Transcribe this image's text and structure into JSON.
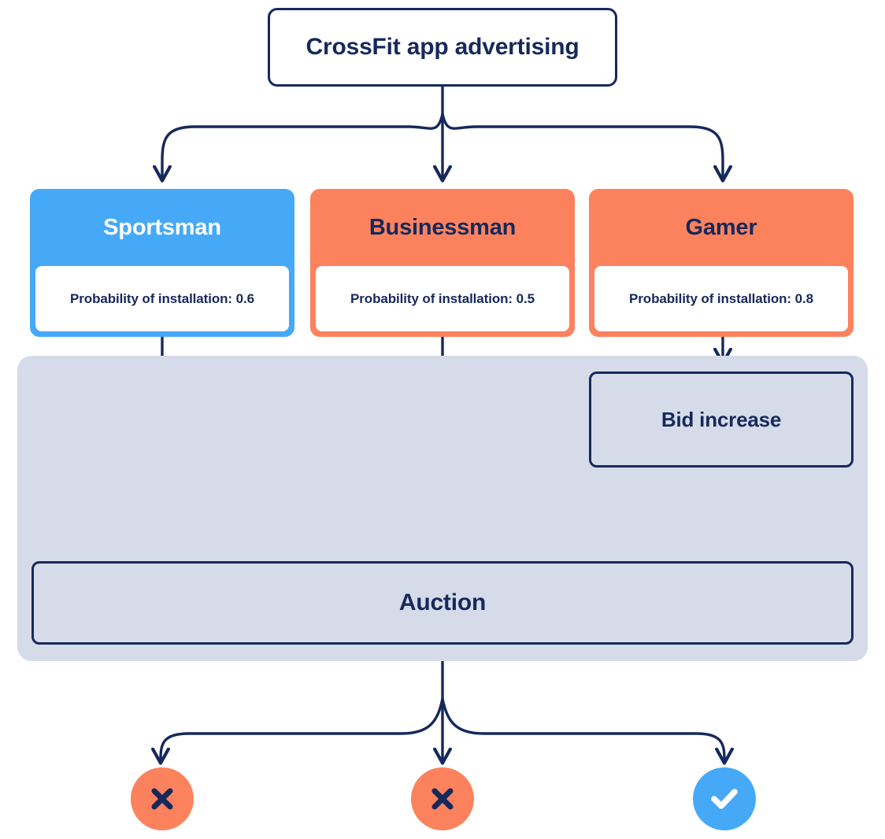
{
  "diagram": {
    "title_node": {
      "label": "CrossFit app advertising"
    },
    "segments": [
      {
        "name": "Sportsman",
        "probability_text": "Probability of installation: 0.6",
        "probability_value": 0.6,
        "color": "#45A9F7",
        "title_color": "#FFFFFF"
      },
      {
        "name": "Businessman",
        "probability_text": "Probability of installation: 0.5",
        "probability_value": 0.5,
        "color": "#FC825E",
        "title_color": "#16295C"
      },
      {
        "name": "Gamer",
        "probability_text": "Probability of installation: 0.8",
        "probability_value": 0.8,
        "color": "#FC825E",
        "title_color": "#16295C"
      }
    ],
    "bid_increase": {
      "label": "Bid increase"
    },
    "auction": {
      "label": "Auction"
    },
    "outcomes": [
      {
        "icon": "cross-icon",
        "result": "rejected",
        "color": "#FC825E",
        "glyph_color": "#16295C"
      },
      {
        "icon": "cross-icon",
        "result": "rejected",
        "color": "#FC825E",
        "glyph_color": "#16295C"
      },
      {
        "icon": "check-icon",
        "result": "won",
        "color": "#45A9F7",
        "glyph_color": "#FFFFFF"
      }
    ],
    "palette": {
      "navy": "#16295C",
      "blue": "#45A9F7",
      "orange": "#FC825E",
      "panel_gray": "#D5DBE8",
      "white": "#FFFFFF"
    }
  }
}
